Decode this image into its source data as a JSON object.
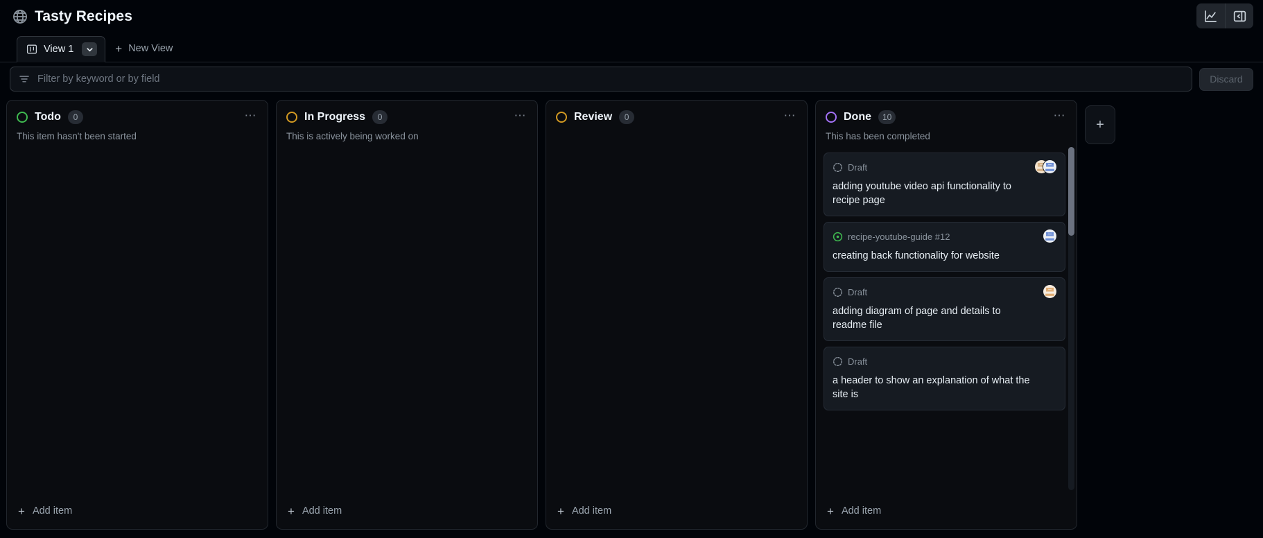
{
  "header": {
    "title": "Tasty Recipes",
    "globe_icon": "globe-icon",
    "insights_label": "Insights",
    "insights_icon": "graph-icon",
    "sidebar_toggle_label": "Toggle sidebar",
    "sidebar_toggle_icon": "sidebar-expand-icon"
  },
  "tabs": {
    "items": [
      {
        "label": "View 1",
        "icon": "project-board-icon",
        "active": true
      }
    ],
    "caret_icon": "chevron-down-icon",
    "new_view_label": "New View",
    "new_view_icon": "plus-icon"
  },
  "filter": {
    "icon": "filter-icon",
    "placeholder": "Filter by keyword or by field",
    "value": "",
    "discard_label": "Discard"
  },
  "board": {
    "add_item_label": "Add item",
    "add_item_icon": "plus-icon",
    "add_column_icon": "plus-icon",
    "column_menu_icon": "kebab-horizontal-icon",
    "columns": [
      {
        "name": "Todo",
        "count": "0",
        "description": "This item hasn't been started",
        "dot_color": "#3fb950",
        "cards": [],
        "has_scrollbar": false
      },
      {
        "name": "In Progress",
        "count": "0",
        "description": "This is actively being worked on",
        "dot_color": "#d29922",
        "cards": [],
        "has_scrollbar": false
      },
      {
        "name": "Review",
        "count": "0",
        "description": "",
        "dot_color": "#d29922",
        "cards": [],
        "has_scrollbar": false
      },
      {
        "name": "Done",
        "count": "10",
        "description": "This has been completed",
        "dot_color": "#a371f7",
        "has_scrollbar": true,
        "cards": [
          {
            "meta_label": "Draft",
            "meta_icon": "draft-dashed-circle-icon",
            "meta_color": "#8b949e",
            "title": "adding youtube video api functionality to recipe page",
            "avatars": [
              {
                "name": "avatar-blue-identicon",
                "base": "#eef1f5",
                "fg": "#6e8fd6"
              },
              {
                "name": "avatar-tan-identicon",
                "base": "#f4e4cf",
                "fg": "#d6b183"
              }
            ]
          },
          {
            "meta_label": "recipe-youtube-guide #12",
            "meta_icon": "issue-closed-icon",
            "meta_color": "#3fb950",
            "title": "creating back functionality for website",
            "avatars": [
              {
                "name": "avatar-blue-identicon",
                "base": "#eef1f5",
                "fg": "#6e8fd6"
              }
            ]
          },
          {
            "meta_label": "Draft",
            "meta_icon": "draft-dashed-circle-icon",
            "meta_color": "#8b949e",
            "title": "adding diagram of page and details to readme file",
            "avatars": [
              {
                "name": "avatar-tan-identicon",
                "base": "#f6ece0",
                "fg": "#e0ad75"
              }
            ]
          },
          {
            "meta_label": "Draft",
            "meta_icon": "draft-dashed-circle-icon",
            "meta_color": "#8b949e",
            "title": "a header to show an explanation of what the site is",
            "avatars": []
          }
        ]
      }
    ]
  }
}
